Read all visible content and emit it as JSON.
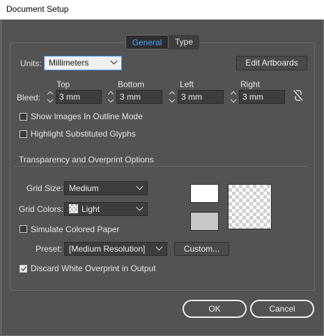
{
  "window": {
    "title": "Document Setup"
  },
  "tabs": [
    {
      "label": "General",
      "selected": true
    },
    {
      "label": "Type",
      "selected": false
    }
  ],
  "units": {
    "label": "Units:",
    "value": "Millimeters"
  },
  "edit_artboards_label": "Edit Artboards",
  "bleed": {
    "label": "Bleed:",
    "top": {
      "label": "Top",
      "value": "3 mm"
    },
    "bottom": {
      "label": "Bottom",
      "value": "3 mm"
    },
    "left": {
      "label": "Left",
      "value": "3 mm"
    },
    "right": {
      "label": "Right",
      "value": "3 mm"
    },
    "link_icon": "chain-broken-icon"
  },
  "checkboxes": {
    "show_images_outline": {
      "label": "Show Images In Outline Mode",
      "checked": false
    },
    "highlight_substituted": {
      "label": "Highlight Substituted Glyphs",
      "checked": false
    }
  },
  "transparency": {
    "section_title": "Transparency and Overprint Options",
    "grid_size": {
      "label": "Grid Size:",
      "value": "Medium"
    },
    "grid_colors": {
      "label": "Grid Colors:",
      "value": "Light"
    },
    "simulate_paper": {
      "label": "Simulate Colored Paper",
      "checked": false
    },
    "preset": {
      "label": "Preset:",
      "value": "[Medium Resolution]"
    },
    "custom_label": "Custom...",
    "discard_white": {
      "label": "Discard White Overprint in Output",
      "checked": true
    },
    "swatch_colors": {
      "top": "#ffffff",
      "bottom": "#c8c8c8"
    }
  },
  "footer": {
    "ok_label": "OK",
    "cancel_label": "Cancel"
  }
}
